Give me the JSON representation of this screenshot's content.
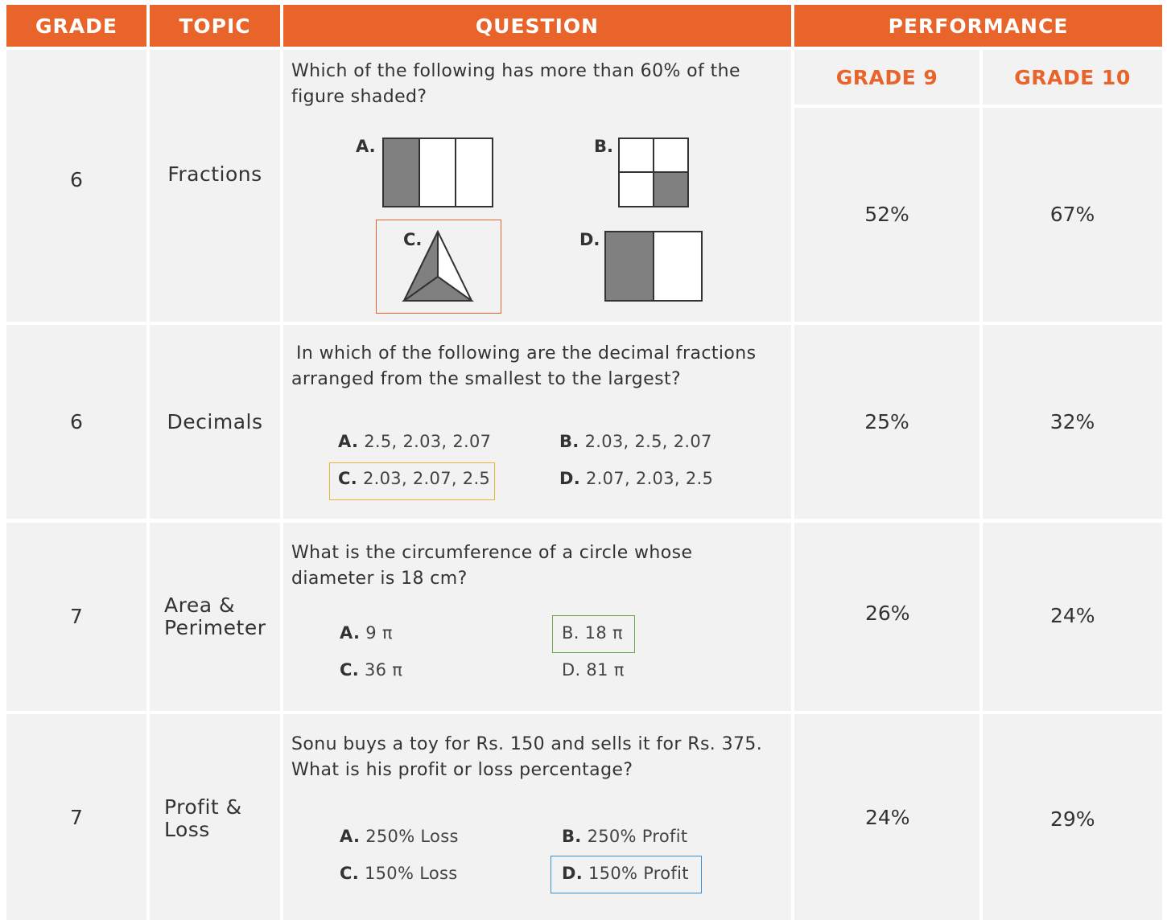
{
  "header": {
    "grade": "GRADE",
    "topic": "TOPIC",
    "question": "QUESTION",
    "performance": "PERFORMANCE",
    "grade9": "GRADE 9",
    "grade10": "GRADE 10"
  },
  "rows": [
    {
      "grade": "6",
      "topic": "Fractions",
      "question": "Which of the following has more than 60% of the figure shaded?",
      "figures": {
        "a": "A.",
        "b": "B.",
        "c": "C.",
        "d": "D."
      },
      "grade9": "52%",
      "grade10": "67%"
    },
    {
      "grade": "6",
      "topic": "Decimals",
      "question": "In which of the following are the decimal fractions arranged from the smallest to the largest?",
      "options": [
        {
          "letter": "A.",
          "text": "2.5, 2.03, 2.07"
        },
        {
          "letter": "B.",
          "text": "2.03, 2.5, 2.07"
        },
        {
          "letter": "C.",
          "text": "2.03, 2.07, 2.5"
        },
        {
          "letter": "D.",
          "text": "2.07, 2.03, 2.5"
        }
      ],
      "grade9": "25%",
      "grade10": "32%"
    },
    {
      "grade": "7",
      "topic_line1": "Area &",
      "topic_line2": "Perimeter",
      "question": "What is the circumference of a circle whose diameter is 18 cm?",
      "options": [
        {
          "letter": "A.",
          "text": "9 π"
        },
        {
          "letter": "",
          "text": "B. 18 π"
        },
        {
          "letter": "C.",
          "text": "36 π"
        },
        {
          "letter": "",
          "text": "D. 81 π"
        }
      ],
      "grade9": "26%",
      "grade10": "24%"
    },
    {
      "grade": "7",
      "topic_line1": "Profit &",
      "topic_line2": "Loss",
      "question": "Sonu buys a toy for Rs. 150 and sells it for Rs. 375. What is his profit or loss percentage?",
      "options": [
        {
          "letter": "A.",
          "text": "250% Loss"
        },
        {
          "letter": "B.",
          "text": "250% Profit"
        },
        {
          "letter": "C.",
          "text": "150% Loss"
        },
        {
          "letter": "D.",
          "text": "150% Profit"
        }
      ],
      "grade9": "24%",
      "grade10": "29%"
    }
  ],
  "colors": {
    "header_bg": "#e8642a",
    "cell_bg": "#f2f2f2",
    "figure_fill": "#808080",
    "highlight_row1": "#e8642a",
    "highlight_row2": "#e8b830",
    "highlight_row3": "#6aaa4a",
    "highlight_row4": "#3a8fd0"
  }
}
